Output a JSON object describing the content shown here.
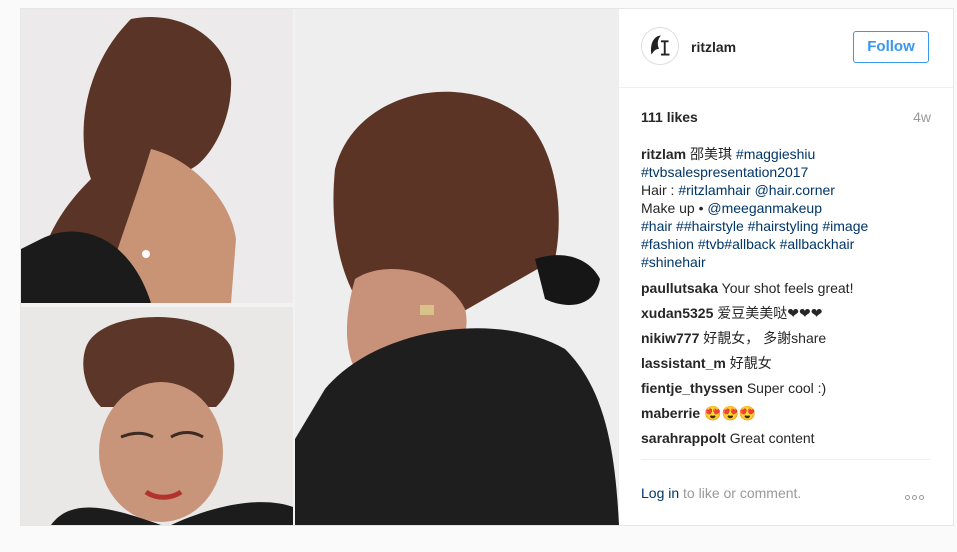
{
  "post": {
    "username": "ritzlam",
    "follow_label": "Follow",
    "likes": "111 likes",
    "time": "4w",
    "caption": {
      "user": "ritzlam",
      "text_1": "邵美琪",
      "tag_1": "#maggieshiu",
      "tag_2": "#tvbsalespresentation2017",
      "text_2": "Hair : ",
      "tag_3": "#ritzlamhair",
      "tag_4": "@hair.corner",
      "text_3": "Make up • ",
      "tag_5": "@meeganmakeup",
      "tag_6": "#hair",
      "text_4": "#",
      "tag_7": "#hairstyle",
      "tag_8": "#hairstyling",
      "tag_9": "#image",
      "tag_10": "#fashion",
      "tag_11": "#tvb",
      "tag_12": "#allback",
      "tag_13": "#allbackhair",
      "tag_14": "#shinehair"
    },
    "comments": [
      {
        "user": "paullutsaka",
        "text": "Your shot feels great!"
      },
      {
        "user": "xudan5325",
        "text": "爱豆美美哒❤❤❤"
      },
      {
        "user": "nikiw777",
        "text": "好靚女， 多謝share"
      },
      {
        "user": "lassistant_m",
        "text": "好靚女"
      },
      {
        "user": "fientje_thyssen",
        "text": "Super cool :)"
      },
      {
        "user": "maberrie",
        "text": "😍😍😍"
      },
      {
        "user": "sarahrappolt",
        "text": "Great content"
      }
    ],
    "login_link": "Log in",
    "login_rest": " to like or comment."
  },
  "colors": {
    "accent": "#3897f0",
    "link": "#003569",
    "muted": "#999999"
  },
  "icons": {
    "more": "more-options-icon",
    "avatar": "profile-avatar"
  }
}
